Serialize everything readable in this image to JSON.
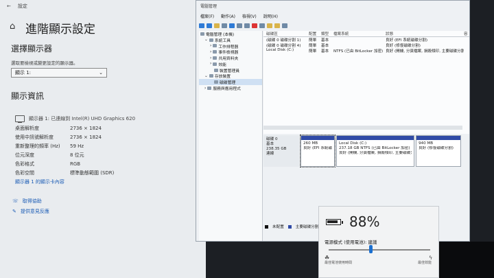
{
  "settings": {
    "window_title": "設定",
    "page_title": "進階顯示設定",
    "select_display_heading": "選擇顯示器",
    "select_display_hint": "選取要檢視或變更設定的顯示器。",
    "display_dropdown_value": "顯示 1:",
    "display_info_heading": "顯示資訊",
    "display_name": "顯示器 1: 已連線到 Intel(R) UHD Graphics 620",
    "info_rows": [
      {
        "label": "桌面解析度",
        "value": "2736 × 1824"
      },
      {
        "label": "使用中訊號解析度",
        "value": "2736 × 1824"
      },
      {
        "label": "重新整理的頻率 (Hz)",
        "value": "59 Hz"
      },
      {
        "label": "位元深度",
        "value": "8 位元"
      },
      {
        "label": "色彩格式",
        "value": "RGB"
      },
      {
        "label": "色彩空間",
        "value": "標準動態範圍 (SDR)"
      }
    ],
    "adapter_link": "顯示器 1 的顯示卡內容",
    "get_help": "取得協助",
    "give_feedback": "提供意見反應"
  },
  "mmc": {
    "title": "電腦管理",
    "menu": [
      "檔案(F)",
      "動作(A)",
      "檢視(V)",
      "說明(H)"
    ],
    "tree": [
      {
        "label": "電腦管理 (本機)",
        "level": 0
      },
      {
        "label": "系統工具",
        "level": 1
      },
      {
        "label": "工作排程器",
        "level": 2
      },
      {
        "label": "事件檢視器",
        "level": 2
      },
      {
        "label": "共用資料夾",
        "level": 2
      },
      {
        "label": "效能",
        "level": 2
      },
      {
        "label": "裝置管理員",
        "level": 2
      },
      {
        "label": "存放裝置",
        "level": 1
      },
      {
        "label": "磁碟管理",
        "level": 2
      },
      {
        "label": "服務與應用程式",
        "level": 1
      }
    ],
    "columns": [
      "磁碟區",
      "配置",
      "類型",
      "檔案系統",
      "狀態",
      "容"
    ],
    "volumes": [
      {
        "name": "(磁碟 0 磁碟分割 1)",
        "layout": "簡單",
        "type": "基本",
        "fs": "",
        "status": "良好 (EFI 系統磁碟分割)"
      },
      {
        "name": "(磁碟 0 磁碟分割 4)",
        "layout": "簡單",
        "type": "基本",
        "fs": "",
        "status": "良好 (修復磁碟分割)"
      },
      {
        "name": "Local Disk (C:)",
        "layout": "簡單",
        "type": "基本",
        "fs": "NTFS (已由 BitLocker 加密)",
        "status": "良好 (開機, 分頁檔案, 損毀傾印, 主要磁碟分割)"
      }
    ],
    "disk": {
      "name": "磁碟 0",
      "type": "基本",
      "size": "238.35 GB",
      "state": "連線",
      "partitions": [
        {
          "label": "",
          "size": "260 MB",
          "status": "良好 (EFI 系統磁碟分割)"
        },
        {
          "label": "Local Disk (C:)",
          "size": "237.18 GB NTFS (已由 BitLocker 加密)",
          "status": "良好 (開機, 分頁檔案, 損毀傾印, 主要磁碟分割)"
        },
        {
          "label": "",
          "size": "940 MB",
          "status": "良好 (修復磁碟分割)"
        }
      ]
    },
    "legend": [
      "未配置",
      "主要磁碟分割"
    ]
  },
  "battery": {
    "percent": "88%",
    "level": 0.88,
    "power_mode": "電源模式 (使用電池): 建議",
    "left_label": "最佳電池使用時間",
    "right_label": "最佳效能",
    "slider_position": 0.41
  }
}
